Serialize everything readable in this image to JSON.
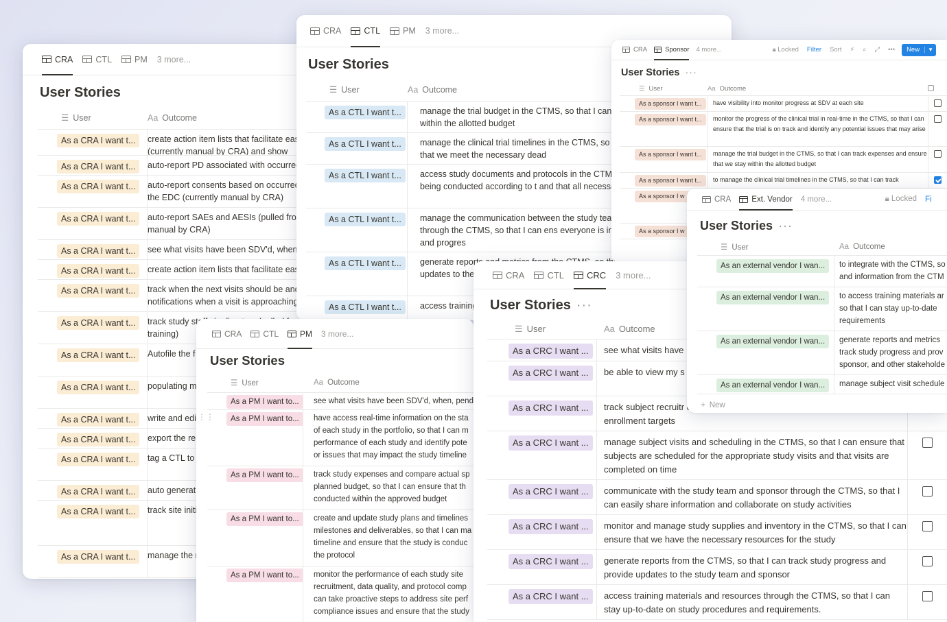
{
  "title": "User Stories",
  "columns": {
    "user": "User",
    "outcome": "Outcome",
    "outcome_prefix": "Aa"
  },
  "tabs": {
    "cra": "CRA",
    "ctl": "CTL",
    "pm": "PM",
    "crc": "CRC",
    "sponsor": "Sponsor",
    "vendor": "Ext. Vendor",
    "more3": "3 more...",
    "more4": "4 more..."
  },
  "toolbar": {
    "locked": "Locked",
    "filter": "Filter",
    "sort": "Sort",
    "new": "New"
  },
  "new_row": "New",
  "cra": {
    "rows": [
      {
        "user": "As a CRA I want t...",
        "outcome": "create action item lists that facilitate easier (currently manual by CRA) and show where"
      },
      {
        "user": "As a CRA I want t...",
        "outcome": "auto-report PD associated with occurred"
      },
      {
        "user": "As a CRA I want t...",
        "outcome": "auto-report consents based on occurred in the EDC (currently manual by CRA)"
      },
      {
        "user": "As a CRA I want t...",
        "outcome": "auto-report SAEs and AESIs (pulled from manual by CRA)"
      },
      {
        "user": "As a CRA I want t...",
        "outcome": "see what visits have been SDV'd, when,"
      },
      {
        "user": "As a CRA I want t...",
        "outcome": "create action item lists that facilitate easier"
      },
      {
        "user": "As a CRA I want t...",
        "outcome": "track when the next visits should be and notifications when a visit is approaching"
      },
      {
        "user": "As a CRA I want t...",
        "outcome": "track study staff via directory (pulled from training)"
      },
      {
        "user": "As a CRA I want t...",
        "outcome": "Autofile the f filing with link"
      },
      {
        "user": "As a CRA I want t...",
        "outcome": "populating m monitoring p"
      },
      {
        "user": "As a CRA I want t...",
        "outcome": "write and edi"
      },
      {
        "user": "As a CRA I want t...",
        "outcome": "export the re"
      },
      {
        "user": "As a CRA I want t...",
        "outcome": "tag a CTL to approved"
      },
      {
        "user": "As a CRA I want t...",
        "outcome": "auto generat"
      },
      {
        "user": "As a CRA I want t...",
        "outcome": "track site initi can ensure th all necessary"
      },
      {
        "user": "As a CRA I want t...",
        "outcome": "manage the r CTMS, so tha"
      }
    ]
  },
  "ctl": {
    "rows": [
      {
        "user": "As a CTL I want t...",
        "outcome": "manage the trial budget in the CTMS, so that I can track and ensure that we stay within the allotted budget"
      },
      {
        "user": "As a CTL I want t...",
        "outcome": "manage the clinical trial timelines in the CTMS, so that I milestones and ensure that we meet the necessary dead"
      },
      {
        "user": "As a CTL I want t...",
        "outcome": "access study documents and protocols in the CTMS, so ensure that the study is being conducted according to t and that all necessary documents are in place"
      },
      {
        "user": "As a CTL I want t...",
        "outcome": "manage the communication between the study team, s other stakeholders through the CTMS, so that I can ens everyone is informed about the trial status and progres"
      },
      {
        "user": "As a CTL I want t...",
        "outcome": "generate reports and metrics from the CTMS, so that I study progress and provide updates to the study team other stakeholde"
      },
      {
        "user": "As a CTL I want t...",
        "outcome": "access training m can stay up-to-da"
      }
    ]
  },
  "sponsor": {
    "rows": [
      {
        "user": "As a sponsor I want t...",
        "outcome": "have visibility into monitor progress at SDV at each site",
        "checked": false
      },
      {
        "user": "As a sponsor I want t...",
        "outcome": "monitor the progress of the clinical trial in real-time in the CTMS, so that I can ensure that the trial is on track and identify any potential issues that may arise",
        "checked": false
      },
      {
        "user": "As a sponsor I want t...",
        "outcome": "manage the trial budget in the CTMS, so that I can track expenses and ensure that we stay within the allotted budget",
        "checked": false
      },
      {
        "user": "As a sponsor I want t...",
        "outcome": "to manage the clinical trial timelines in the CTMS, so that I can track",
        "checked": true
      },
      {
        "user": "As a sponsor I w",
        "outcome": ""
      },
      {
        "user": "As a sponsor I w",
        "outcome": ""
      }
    ]
  },
  "pm": {
    "rows": [
      {
        "user": "As a PM I want to...",
        "outcome": "see what visits have been SDV'd, when, pend"
      },
      {
        "user": "As a PM I want to...",
        "outcome": "have access real-time information on the sta of each study in the portfolio, so that I can m performance of each study and identify pote or issues that may impact the study timeline"
      },
      {
        "user": "As a PM I want to...",
        "outcome": "track study expenses and compare actual sp planned budget, so that I can ensure that th conducted within the approved budget"
      },
      {
        "user": "As a PM I want to...",
        "outcome": "create and update study plans and timelines milestones and deliverables, so that I can ma timeline and ensure that the study is conduc the protocol"
      },
      {
        "user": "As a PM I want to...",
        "outcome": "monitor the performance of each study site recruitment, data quality, and protocol comp can take proactive steps to address site perf compliance issues and ensure that the study"
      }
    ]
  },
  "crc": {
    "rows": [
      {
        "user": "As a CRC I want ...",
        "outcome": "see what visits have"
      },
      {
        "user": "As a CRC I want ...",
        "outcome": "be able to view my s that I can easily acce"
      },
      {
        "user": "As a CRC I want ...",
        "outcome": "track subject recruitr enrollment and ensure that we are meeting our enrollment targets"
      },
      {
        "user": "As a CRC I want ...",
        "outcome": "manage subject visits and scheduling in the CTMS, so that I can ensure that subjects are scheduled for the appropriate study visits and that visits are completed on time",
        "checked": false
      },
      {
        "user": "As a CRC I want ...",
        "outcome": "communicate with the study team and sponsor through the CTMS, so that I can easily share information and collaborate on study activities",
        "checked": false
      },
      {
        "user": "As a CRC I want ...",
        "outcome": "monitor and manage study supplies and inventory in the CTMS, so that I can ensure that we have the necessary resources for the study",
        "checked": false
      },
      {
        "user": "As a CRC I want ...",
        "outcome": "generate reports from the CTMS, so that I can track study progress and provide updates to the study team and sponsor",
        "checked": false
      },
      {
        "user": "As a CRC I want ...",
        "outcome": "access training materials and resources through the CTMS, so that I can stay up-to-date on study procedures and requirements.",
        "checked": false
      }
    ]
  },
  "vendor": {
    "rows": [
      {
        "user": "As an external vendor I wan...",
        "outcome": "to integrate with the CTMS, so and information from the CTM"
      },
      {
        "user": "As an external vendor I wan...",
        "outcome": "to access training materials ar so that I can stay up-to-date requirements"
      },
      {
        "user": "As an external vendor I wan...",
        "outcome": "generate reports and metrics track study progress and prov sponsor, and other stakeholde"
      },
      {
        "user": "As an external vendor I wan...",
        "outcome": "manage subject visit schedule"
      }
    ]
  },
  "colors": {
    "accent": "#2383e2",
    "cra": "#fbecd4",
    "ctl": "#d8e8f4",
    "pm": "#f8dde6",
    "crc": "#e7ddf2",
    "sponsor": "#f5e0d6",
    "vendor": "#dcefdf"
  }
}
